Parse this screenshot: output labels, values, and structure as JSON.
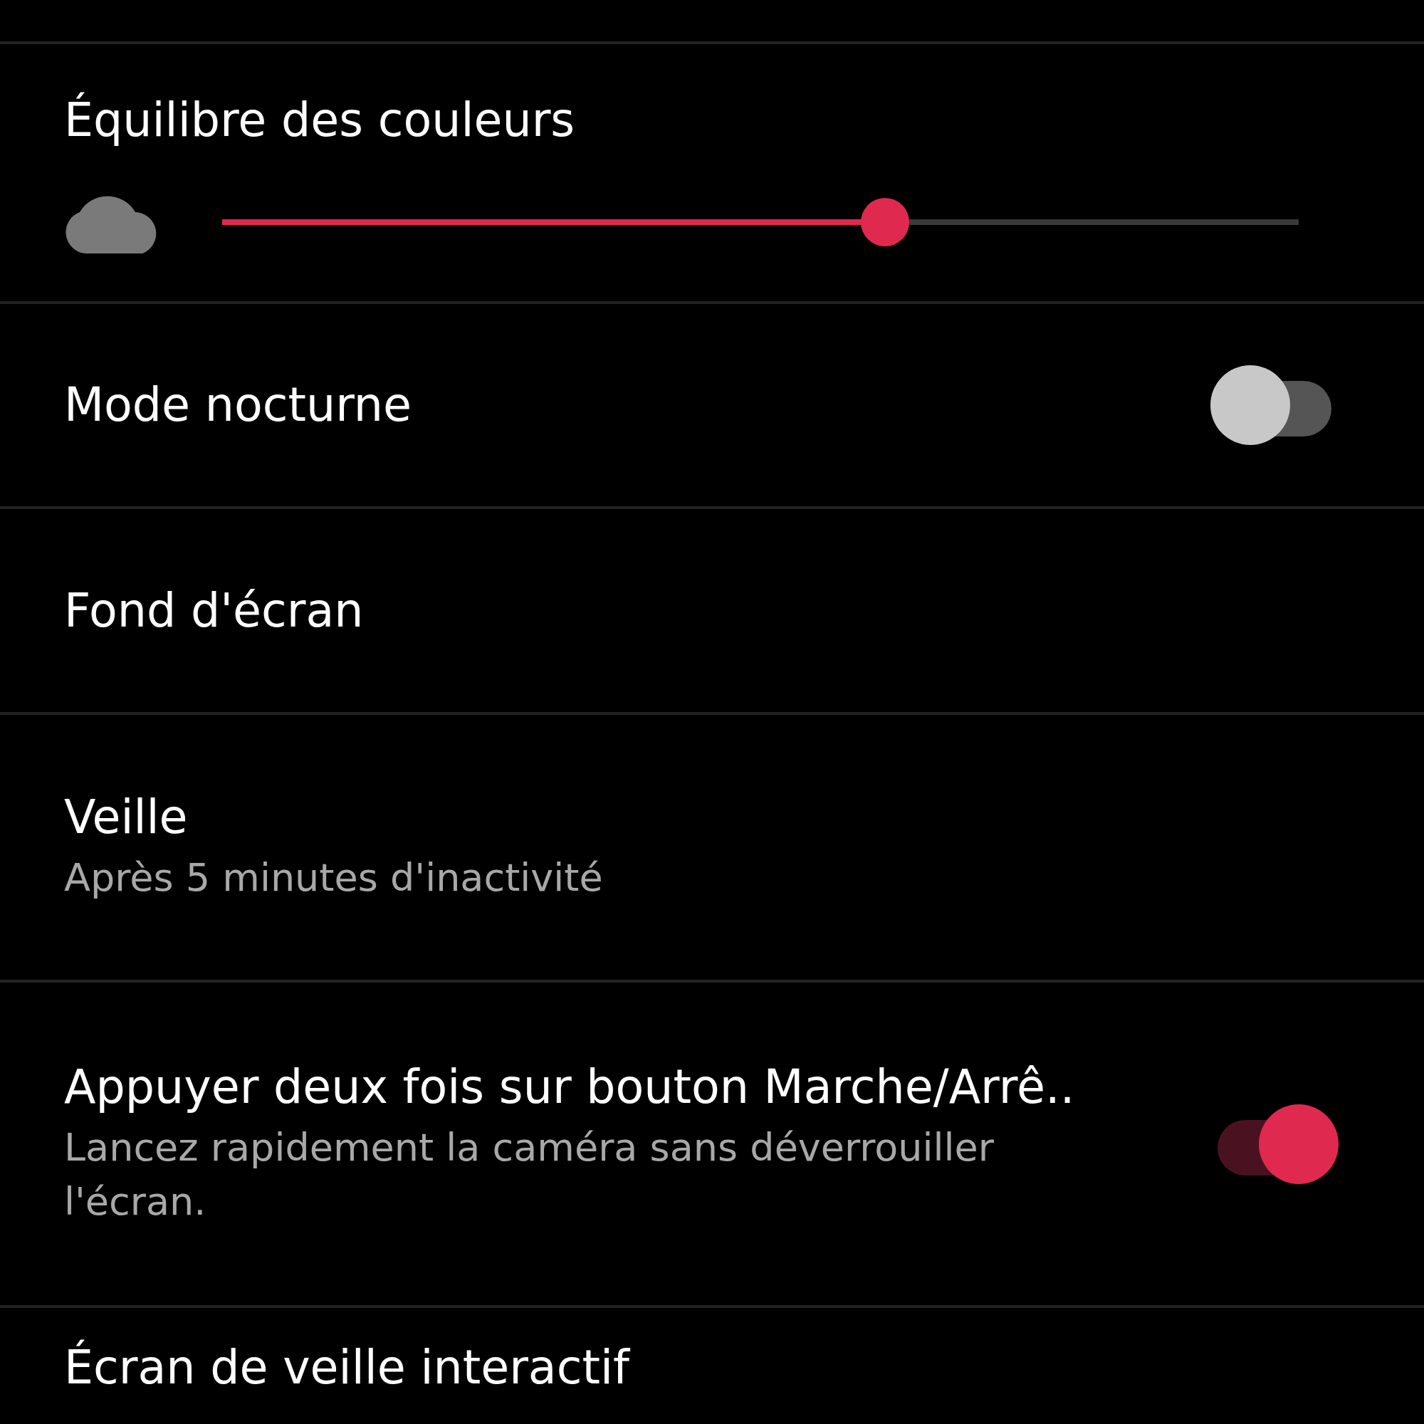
{
  "settings": [
    {
      "kind": "slider",
      "title": "Équilibre des couleurs",
      "level": 0.616
    },
    {
      "kind": "toggle",
      "title": "Mode nocturne",
      "on": false
    },
    {
      "kind": "plain",
      "title": "Fond d'écran"
    },
    {
      "kind": "plain",
      "title": "Veille",
      "subtitle": "Après 5 minutes d'inactivité"
    },
    {
      "kind": "toggle",
      "title": "Appuyer deux fois sur bouton Marche/Arrê..",
      "subtitle": "Lancez rapidement la caméra sans déverrouiller l'écran.",
      "on": true
    },
    {
      "kind": "plain",
      "title": "Écran de veille interactif"
    }
  ]
}
